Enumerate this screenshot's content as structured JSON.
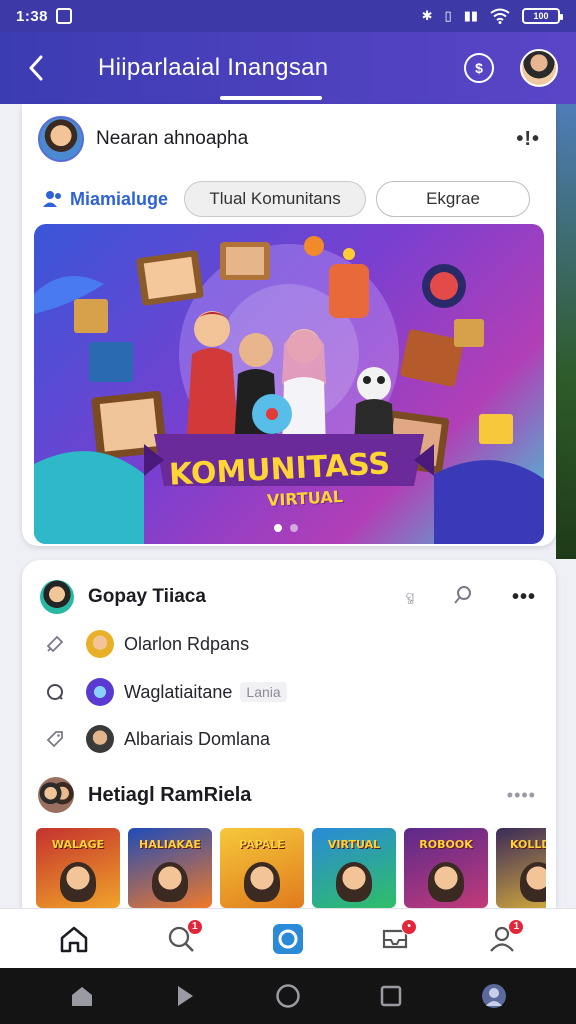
{
  "status_bar": {
    "time": "1:38",
    "battery": "100"
  },
  "header": {
    "title": "Hiiparlaaial Inangsan",
    "chat_glyph": "$"
  },
  "post": {
    "author": "Nearan ahnoapha",
    "menu": "•!•",
    "tabs": {
      "active": "Miamialuge",
      "pill1": "Tlual Komunitans",
      "pill2": "Ekgrae"
    },
    "banner": {
      "title": "KOMUNITASS",
      "subtitle": "VIRTUAL",
      "slide_count": 2,
      "active_slide": 1
    }
  },
  "group": {
    "name": "Gopay Tiiaca",
    "tag": "ସ୍ଥ",
    "menu": "•••",
    "items": [
      {
        "icon": "pin-icon",
        "label": "Olarlon Rdpans",
        "tag": ""
      },
      {
        "icon": "circle-refresh-icon",
        "label": "Waglatiaitane",
        "tag": "Lania"
      },
      {
        "icon": "tag-icon",
        "label": "Albariais Domlana",
        "tag": ""
      }
    ]
  },
  "section": {
    "title": "Hetiagl RamRiela",
    "menu": "••••",
    "games": [
      {
        "title": "WALAGE",
        "colors": [
          "#c4322e",
          "#f0a32a"
        ]
      },
      {
        "title": "HALIAKAE",
        "colors": [
          "#1f4bb8",
          "#f07a2a"
        ]
      },
      {
        "title": "PAPALE",
        "colors": [
          "#f6c83a",
          "#e07b1e"
        ]
      },
      {
        "title": "VIRTUAL",
        "colors": [
          "#2a8ad8",
          "#2fbf66"
        ]
      },
      {
        "title": "ROBOOK",
        "colors": [
          "#5a2a8a",
          "#c23a7a"
        ]
      },
      {
        "title": "KOLLDES",
        "colors": [
          "#3a2a5a",
          "#e0b43a"
        ]
      }
    ]
  },
  "bottom_nav": {
    "items": [
      {
        "name": "home",
        "badge": ""
      },
      {
        "name": "search",
        "badge": "1"
      },
      {
        "name": "camera",
        "badge": ""
      },
      {
        "name": "inbox",
        "badge": "•"
      },
      {
        "name": "profile",
        "badge": "1"
      }
    ]
  },
  "colors": {
    "brand": "#3d3aa8",
    "accent": "#2f62d8",
    "badge": "#e4263a"
  }
}
